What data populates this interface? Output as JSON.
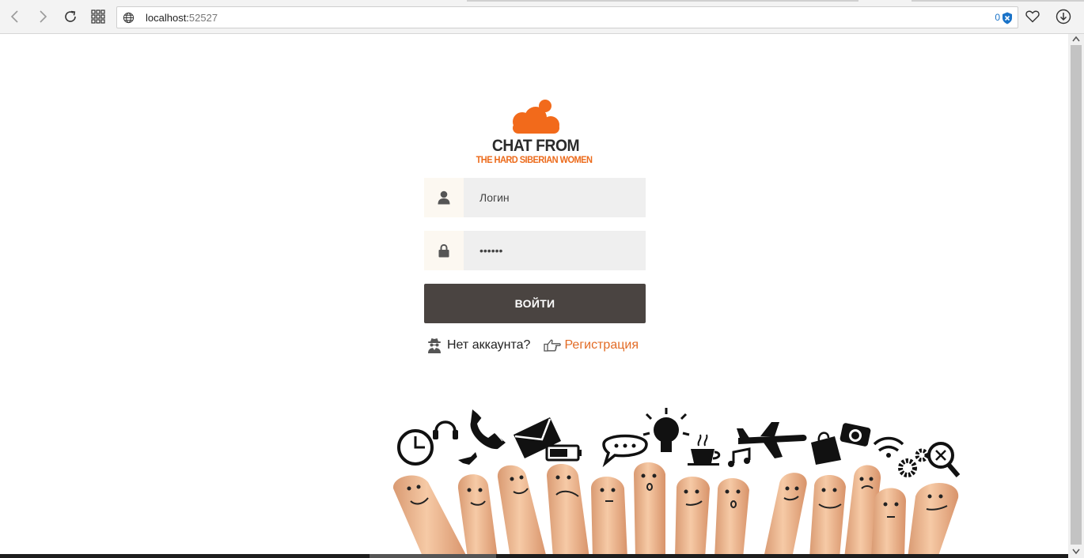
{
  "browser": {
    "url_host": "localhost:",
    "url_port": "52527",
    "adblock_count": "0",
    "icons": {
      "back": "back-arrow-icon",
      "forward": "forward-arrow-icon",
      "reload": "reload-icon",
      "speed_dial": "grid-icon",
      "site_info": "globe-icon",
      "adblock": "shield-icon",
      "bookmark": "heart-icon",
      "downloads": "download-icon"
    }
  },
  "logo": {
    "title": "CHAT FROM",
    "subtitle": "THE HARD SIBERIAN WOMEN",
    "cloud_color": "#f26a1b"
  },
  "form": {
    "login_placeholder": "Логин",
    "password_value": "123456",
    "submit_label": "ВОЙТИ",
    "no_account_text": "Нет аккаунта?",
    "register_link": "Регистрация"
  },
  "colors": {
    "accent": "#e26b25",
    "button_bg": "#4a4441",
    "input_bg": "#efefef"
  }
}
